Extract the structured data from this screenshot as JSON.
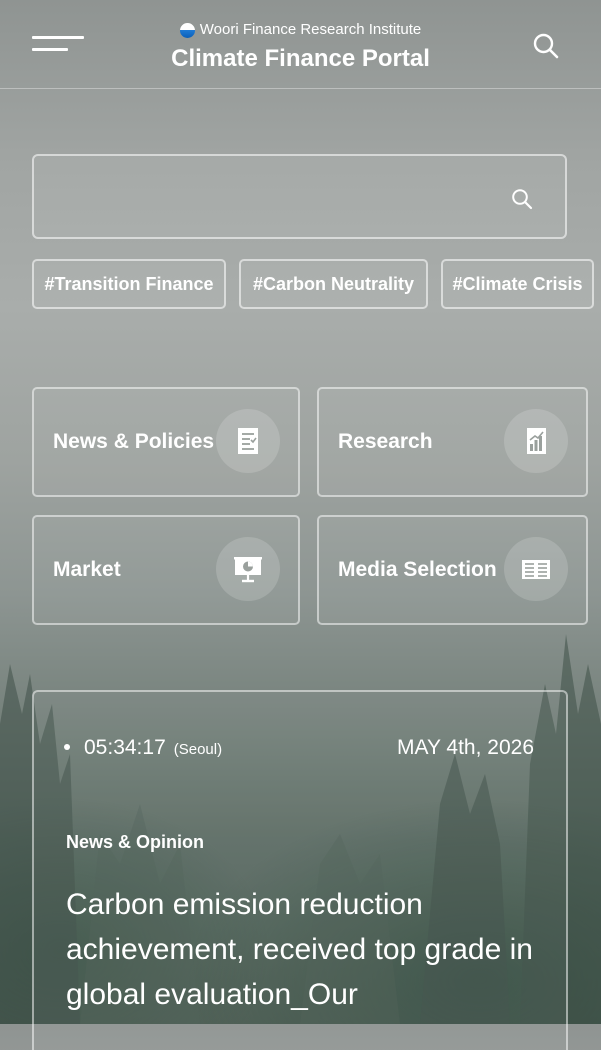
{
  "header": {
    "org_name": "Woori Finance Research Institute",
    "portal_title": "Climate Finance Portal",
    "menu_icon": "hamburger-menu-icon",
    "search_icon": "search-icon"
  },
  "search": {
    "placeholder": "",
    "value": "",
    "icon": "search-icon"
  },
  "tags": [
    {
      "label": "#Transition Finance"
    },
    {
      "label": "#Carbon Neutrality"
    },
    {
      "label": "#Climate Crisis"
    }
  ],
  "categories": [
    {
      "label": "News & Policies",
      "icon": "document-checklist-icon"
    },
    {
      "label": "Research",
      "icon": "report-chart-icon"
    },
    {
      "label": "Market",
      "icon": "presentation-board-icon"
    },
    {
      "label": "Media Selection",
      "icon": "newspaper-icon"
    }
  ],
  "panel": {
    "time": "05:34:17",
    "city": "(Seoul)",
    "date": "MAY 4th, 2026",
    "section": "News & Opinion",
    "headline": "Carbon emission reduction achievement, received top grade in global evaluation_Our"
  },
  "colors": {
    "text": "#ffffff",
    "logo_blue": "#0b5fb8"
  }
}
